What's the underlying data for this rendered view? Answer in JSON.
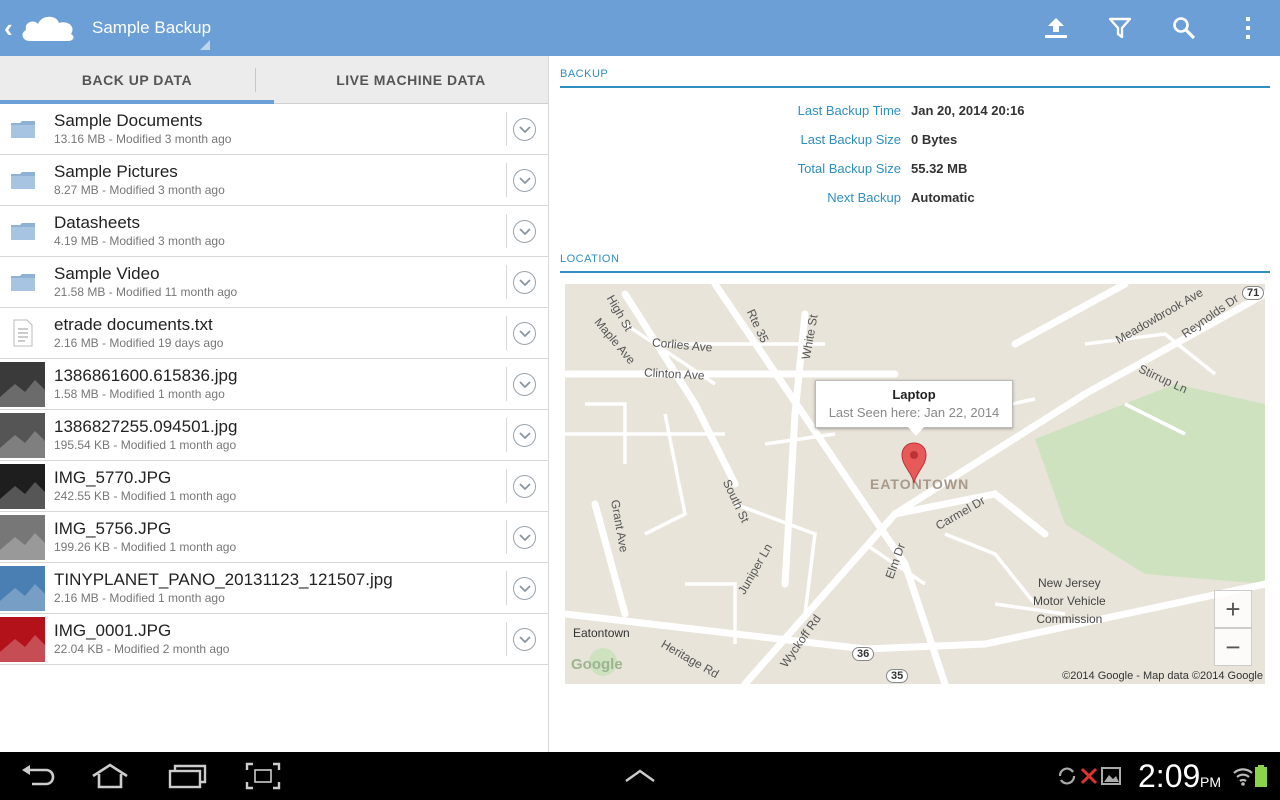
{
  "app": {
    "title": "Sample Backup",
    "accent": "#6b9fd6"
  },
  "action_icons": [
    "upload-icon",
    "filter-icon",
    "search-icon",
    "overflow-menu-icon"
  ],
  "tabs": [
    {
      "label": "BACK UP DATA",
      "active": true
    },
    {
      "label": "LIVE MACHINE DATA",
      "active": false
    }
  ],
  "files": [
    {
      "name": "Sample Documents",
      "meta": "13.16 MB - Modified 3 month ago",
      "icon": "folder-icon"
    },
    {
      "name": "Sample Pictures",
      "meta": "8.27 MB - Modified 3 month ago",
      "icon": "folder-icon"
    },
    {
      "name": "Datasheets",
      "meta": "4.19 MB - Modified 3 month ago",
      "icon": "folder-icon"
    },
    {
      "name": "Sample Video",
      "meta": "21.58 MB - Modified 11 month ago",
      "icon": "folder-icon"
    },
    {
      "name": "etrade documents.txt",
      "meta": "2.16 MB - Modified 19 days ago",
      "icon": "text-file-icon"
    },
    {
      "name": "1386861600.615836.jpg",
      "meta": "1.58 MB - Modified 1 month ago",
      "icon": "image-thumbnail"
    },
    {
      "name": "1386827255.094501.jpg",
      "meta": "195.54 KB - Modified 1 month ago",
      "icon": "image-thumbnail"
    },
    {
      "name": "IMG_5770.JPG",
      "meta": "242.55 KB - Modified 1 month ago",
      "icon": "image-thumbnail"
    },
    {
      "name": "IMG_5756.JPG",
      "meta": "199.26 KB - Modified 1 month ago",
      "icon": "image-thumbnail"
    },
    {
      "name": "TINYPLANET_PANO_20131123_121507.jpg",
      "meta": "2.16 MB - Modified 1 month ago",
      "icon": "image-thumbnail"
    },
    {
      "name": "IMG_0001.JPG",
      "meta": "22.04 KB - Modified 2 month ago",
      "icon": "image-thumbnail"
    }
  ],
  "backup": {
    "heading": "BACKUP",
    "rows": [
      {
        "label": "Last Backup Time",
        "value": "Jan 20, 2014 20:16"
      },
      {
        "label": "Last Backup Size",
        "value": "0 Bytes"
      },
      {
        "label": "Total Backup Size",
        "value": "55.32 MB"
      },
      {
        "label": "Next Backup",
        "value": "Automatic"
      }
    ]
  },
  "location": {
    "heading": "LOCATION",
    "marker_title": "Laptop",
    "marker_subtitle": "Last Seen here: Jan 22, 2014",
    "town": "EATONTOWN",
    "copyright": "©2014 Google - Map data ©2014 Google",
    "zoom_in": "+",
    "zoom_out": "−",
    "labels": {
      "high_st": "High St",
      "maple_ave": "Maple Ave",
      "corlies_ave": "Corlies Ave",
      "clinton_ave": "Clinton Ave",
      "rte35": "Rte 35",
      "white_st": "White St",
      "meadowbrook": "Meadowbrook Ave",
      "reynolds": "Reynolds Dr",
      "stirrup": "Stirrup Ln",
      "south_st": "South St",
      "grant_ave": "Grant Ave",
      "carmel_dr": "Carmel Dr",
      "juniper": "Juniper Ln",
      "elm_dr": "Elm Dr",
      "wyckoff": "Wyckoff Rd",
      "heritage": "Heritage Rd",
      "eatontown": "Eatontown",
      "google": "Google",
      "njmvc": "New Jersey\nMotor Vehicle\nCommission",
      "r71": "71",
      "r36": "36",
      "r35": "35"
    }
  },
  "status": {
    "time": "2:09",
    "ampm": "PM"
  }
}
